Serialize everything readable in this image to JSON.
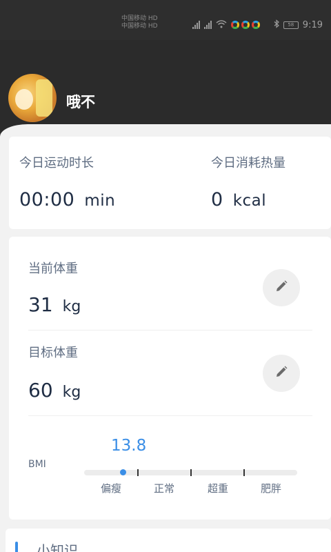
{
  "status_bar": {
    "carrier_1": "中国移动",
    "carrier_2": "中国移动",
    "battery": "58",
    "time": "9:19"
  },
  "profile": {
    "username": "哦不"
  },
  "today": {
    "duration_label": "今日运动时长",
    "duration_value": "00:00",
    "duration_unit": "min",
    "calories_label": "今日消耗热量",
    "calories_value": "0",
    "calories_unit": "kcal"
  },
  "weight": {
    "current_label": "当前体重",
    "current_value": "31",
    "current_unit": "kg",
    "target_label": "目标体重",
    "target_value": "60",
    "target_unit": "kg"
  },
  "bmi": {
    "label": "BMI",
    "value": "13.8",
    "categories": [
      "偏瘦",
      "正常",
      "超重",
      "肥胖"
    ],
    "indicator_color": "#3a8ee6"
  },
  "tips": {
    "title": "小知识"
  },
  "icons": {
    "edit": "pencil-icon",
    "bluetooth": "bluetooth-icon",
    "wifi": "wifi-icon"
  }
}
